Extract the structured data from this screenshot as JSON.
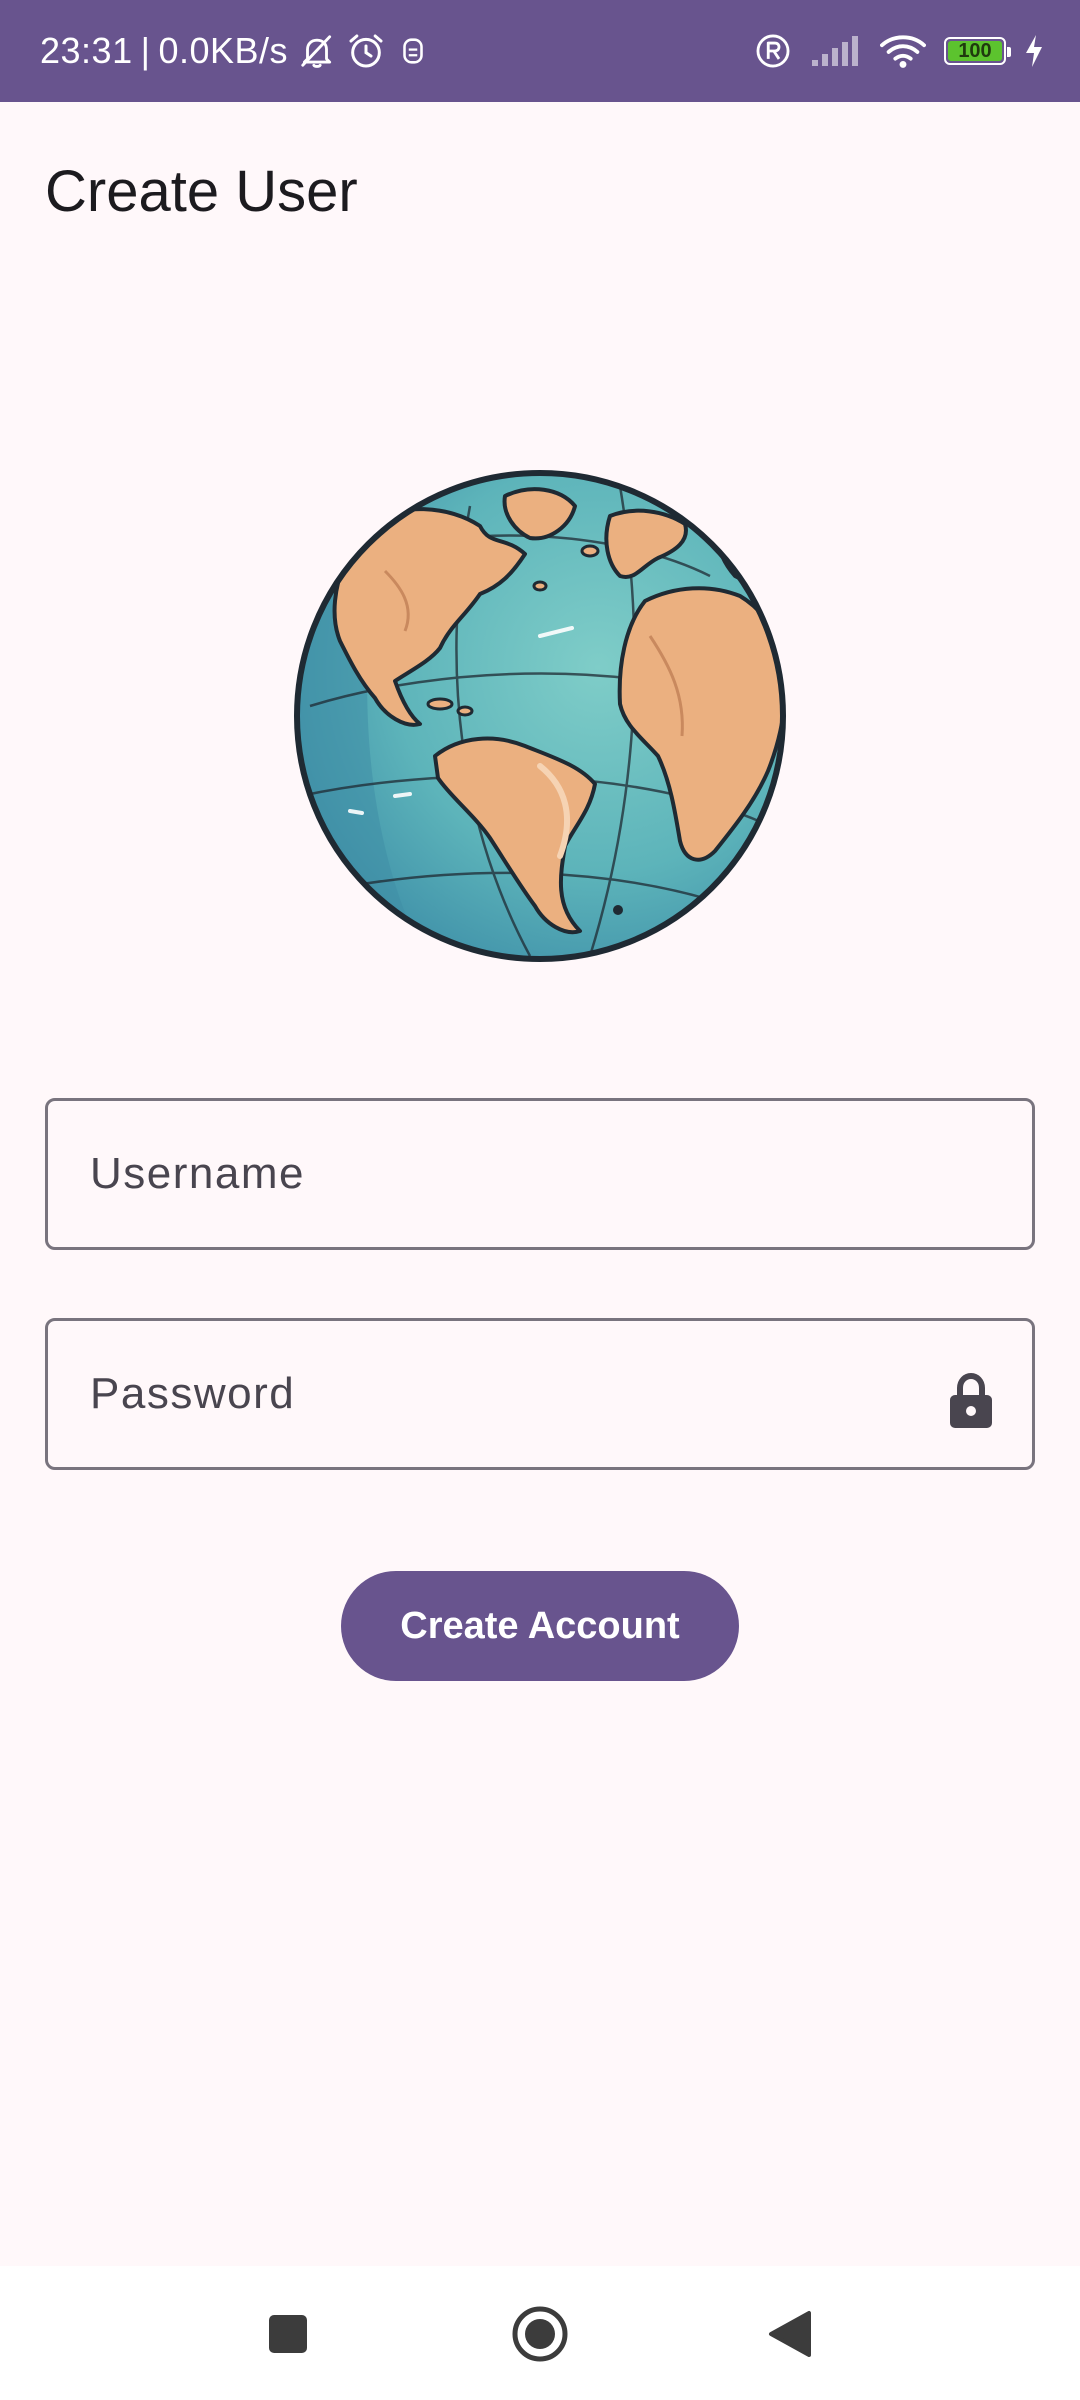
{
  "status_bar": {
    "time": "23:31",
    "separator": "|",
    "network_speed": "0.0KB/s",
    "left_icons": [
      "bell-off-icon",
      "alarm-icon",
      "notification-icon"
    ],
    "right_icons": [
      "registered-icon",
      "signal-icon",
      "wifi-icon",
      "battery-icon",
      "charging-icon"
    ],
    "battery_level": "100",
    "background_color": "#68548E",
    "battery_color": "#5CC32E"
  },
  "screen": {
    "title": "Create User",
    "illustration": "globe-illustration"
  },
  "form": {
    "username": {
      "value": "",
      "placeholder": "Username"
    },
    "password": {
      "value": "",
      "placeholder": "Password",
      "trailing_icon": "lock-icon"
    },
    "submit_label": "Create Account"
  },
  "nav_bar": {
    "buttons": [
      "recents-button",
      "home-button",
      "back-button"
    ]
  },
  "theme": {
    "primary": "#68548E",
    "background": "#FFF8FA",
    "outline": "#79747E",
    "on_surface": "#1C1B1F"
  }
}
